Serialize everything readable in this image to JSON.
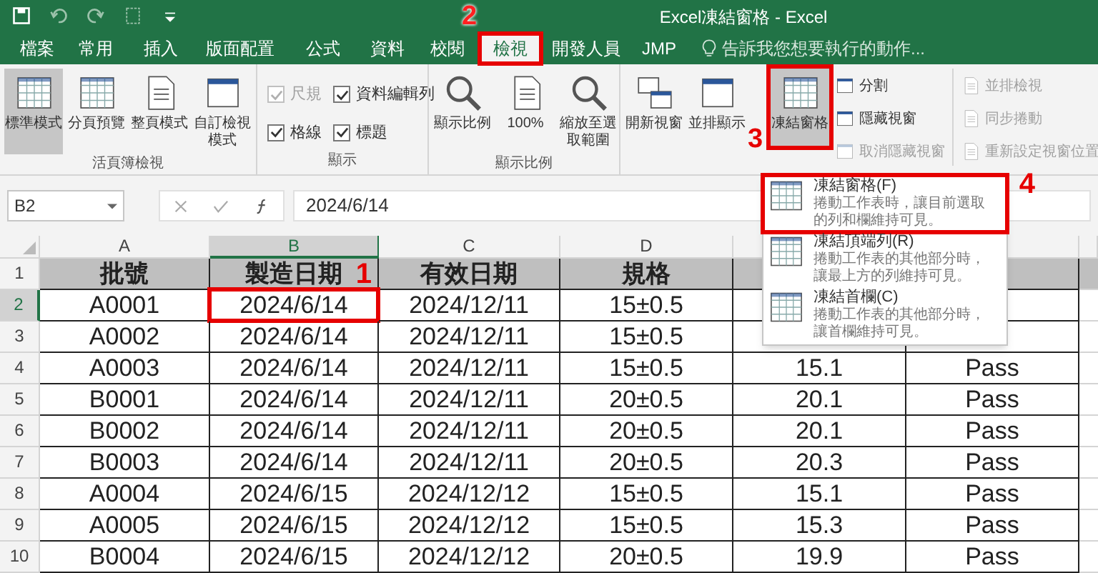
{
  "window": {
    "title": "Excel凍結窗格 - Excel"
  },
  "tabs": [
    {
      "label": "檔案",
      "selected": false
    },
    {
      "label": "常用",
      "selected": false
    },
    {
      "label": "插入",
      "selected": false
    },
    {
      "label": "版面配置",
      "selected": false
    },
    {
      "label": "公式",
      "selected": false
    },
    {
      "label": "資料",
      "selected": false
    },
    {
      "label": "校閱",
      "selected": false
    },
    {
      "label": "檢視",
      "selected": true,
      "highlighted": true,
      "callout": "2"
    },
    {
      "label": "開發人員",
      "selected": false
    },
    {
      "label": "JMP",
      "selected": false
    }
  ],
  "tell_me": {
    "placeholder": "告訴我您想要執行的動作..."
  },
  "ribbon": {
    "groups": [
      {
        "label": "活頁簿檢視",
        "items": [
          {
            "kind": "large",
            "label": "標準模式",
            "selected": true
          },
          {
            "kind": "large",
            "label": "分頁預覽",
            "selected": false
          },
          {
            "kind": "large",
            "label": "整頁模式",
            "selected": false
          },
          {
            "kind": "large",
            "label": "自訂檢視模式",
            "selected": false
          }
        ]
      },
      {
        "label": "顯示",
        "items": [
          {
            "kind": "check",
            "label": "尺規",
            "checked": true,
            "disabled": true
          },
          {
            "kind": "check",
            "label": "資料編輯列",
            "checked": true,
            "disabled": false
          },
          {
            "kind": "check",
            "label": "格線",
            "checked": true,
            "disabled": false
          },
          {
            "kind": "check",
            "label": "標題",
            "checked": true,
            "disabled": false
          }
        ]
      },
      {
        "label": "顯示比例",
        "items": [
          {
            "kind": "large",
            "label": "顯示比例",
            "selected": false
          },
          {
            "kind": "large",
            "label": "100%",
            "selected": false
          },
          {
            "kind": "large",
            "label": "縮放至選取範圍",
            "selected": false
          }
        ]
      },
      {
        "items": [
          {
            "kind": "large",
            "label": "開新視窗",
            "selected": false
          },
          {
            "kind": "large",
            "label": "並排顯示",
            "selected": false
          },
          {
            "kind": "large",
            "label": "凍結窗格",
            "selected": true,
            "highlighted": true,
            "callout": "3"
          },
          {
            "kind": "small",
            "label": "分割",
            "disabled": false
          },
          {
            "kind": "small",
            "label": "隱藏視窗",
            "disabled": false
          },
          {
            "kind": "small",
            "label": "取消隱藏視窗",
            "disabled": true
          },
          {
            "kind": "small",
            "label": "並排檢視",
            "disabled": true
          },
          {
            "kind": "small",
            "label": "同步捲動",
            "disabled": true
          },
          {
            "kind": "small",
            "label": "重新設定視窗位置",
            "disabled": true
          }
        ]
      }
    ]
  },
  "formula_bar": {
    "name_box": "B2",
    "formula": "2024/6/14"
  },
  "sheet": {
    "columns": [
      {
        "letter": "A",
        "selected": false
      },
      {
        "letter": "B",
        "selected": true
      },
      {
        "letter": "C",
        "selected": false
      },
      {
        "letter": "D",
        "selected": false
      },
      {
        "selected": false
      },
      {
        "selected": false
      },
      {
        "selected": false
      }
    ],
    "rows": [
      {
        "number": "1",
        "kind": "header",
        "selected": false,
        "cells": [
          "批號",
          "製造日期",
          "有效日期",
          "規格",
          null,
          null,
          null
        ]
      },
      {
        "number": "2",
        "kind": "data",
        "selected": true,
        "cells": [
          "A0001",
          {
            "text": "2024/6/14",
            "highlighted": true,
            "callout": "1"
          },
          "2024/12/11",
          "15±0.5",
          null,
          null,
          null
        ]
      },
      {
        "number": "3",
        "kind": "data",
        "selected": false,
        "cells": [
          "A0002",
          "2024/6/14",
          "2024/12/11",
          "15±0.5",
          null,
          null,
          null
        ]
      },
      {
        "number": "4",
        "kind": "data",
        "selected": false,
        "cells": [
          "A0003",
          "2024/6/14",
          "2024/12/11",
          "15±0.5",
          "15.1",
          "Pass",
          null
        ]
      },
      {
        "number": "5",
        "kind": "data",
        "selected": false,
        "cells": [
          "B0001",
          "2024/6/14",
          "2024/12/11",
          "20±0.5",
          "20.1",
          "Pass",
          null
        ]
      },
      {
        "number": "6",
        "kind": "data",
        "selected": false,
        "cells": [
          "B0002",
          "2024/6/14",
          "2024/12/11",
          "20±0.5",
          "20.1",
          "Pass",
          null
        ]
      },
      {
        "number": "7",
        "kind": "data",
        "selected": false,
        "cells": [
          "B0003",
          "2024/6/14",
          "2024/12/11",
          "20±0.5",
          "20.3",
          "Pass",
          null
        ]
      },
      {
        "number": "8",
        "kind": "data",
        "selected": false,
        "cells": [
          "A0004",
          "2024/6/15",
          "2024/12/12",
          "15±0.5",
          "15.1",
          "Pass",
          null
        ]
      },
      {
        "number": "9",
        "kind": "data",
        "selected": false,
        "cells": [
          "A0005",
          "2024/6/15",
          "2024/12/12",
          "15±0.5",
          "15.3",
          "Pass",
          null
        ]
      },
      {
        "number": "10",
        "kind": "data",
        "selected": false,
        "cells": [
          "B0004",
          "2024/6/15",
          "2024/12/12",
          "20±0.5",
          "19.9",
          "Pass",
          null
        ]
      }
    ]
  },
  "freeze_menu": {
    "items": [
      {
        "title": "凍結窗格(F)",
        "description": "捲動工作表時，讓目前選取的列和欄維持可見。",
        "highlighted": true,
        "callout": "4"
      },
      {
        "title": "凍結頂端列(R)",
        "description": "捲動工作表的其他部分時，讓最上方的列維持可見。",
        "highlighted": false
      },
      {
        "title": "凍結首欄(C)",
        "description": "捲動工作表的其他部分時，讓首欄維持可見。",
        "highlighted": false
      }
    ]
  }
}
